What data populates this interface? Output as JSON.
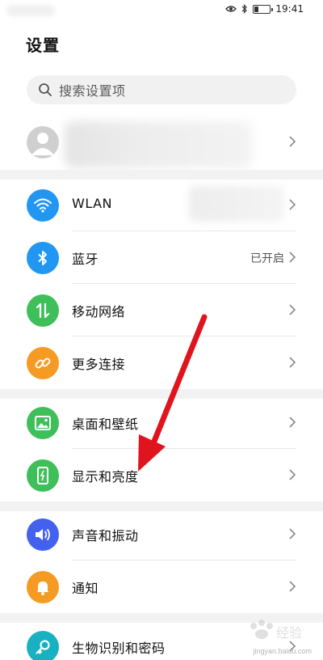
{
  "status_bar": {
    "time": "19:41"
  },
  "header": {
    "title": "设置"
  },
  "search": {
    "placeholder": "搜索设置项"
  },
  "sections": [
    {
      "items": [
        {
          "key": "wlan",
          "label": "WLAN",
          "icon": "wifi-icon",
          "color": "#2196f3"
        },
        {
          "key": "bluetooth",
          "label": "蓝牙",
          "value": "已开启",
          "icon": "bluetooth-icon",
          "color": "#2196f3"
        },
        {
          "key": "mobile",
          "label": "移动网络",
          "icon": "mobile-data-icon",
          "color": "#3fbf5a"
        },
        {
          "key": "more",
          "label": "更多连接",
          "icon": "link-icon",
          "color": "#f59a23"
        }
      ]
    },
    {
      "items": [
        {
          "key": "wallpaper",
          "label": "桌面和壁纸",
          "icon": "image-icon",
          "color": "#3fbf5a"
        },
        {
          "key": "display",
          "label": "显示和亮度",
          "icon": "phone-display-icon",
          "color": "#3fbf5a"
        }
      ]
    },
    {
      "items": [
        {
          "key": "sound",
          "label": "声音和振动",
          "icon": "speaker-icon",
          "color": "#4361ee"
        },
        {
          "key": "notify",
          "label": "通知",
          "icon": "bell-icon",
          "color": "#f59a23"
        }
      ]
    },
    {
      "items": [
        {
          "key": "biometric",
          "label": "生物识别和密码",
          "icon": "key-icon",
          "color": "#17b1c2"
        }
      ]
    }
  ],
  "watermark": {
    "text": "jingyan.baidu.com"
  },
  "annotation": {
    "arrow_color": "#e0141e"
  }
}
